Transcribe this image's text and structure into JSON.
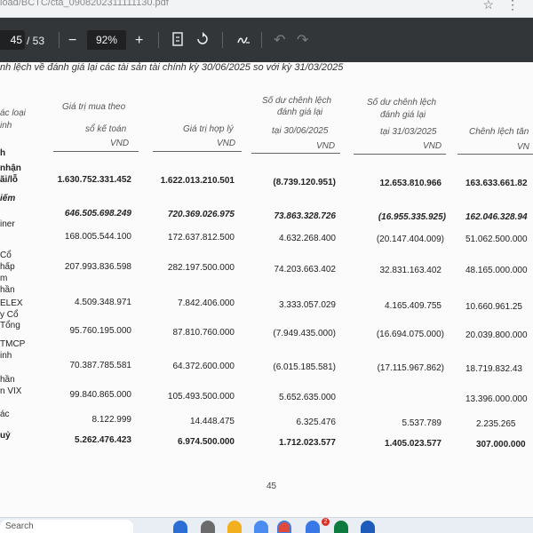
{
  "browser": {
    "url_fragment": "load/BCTC/cta_0908202311111130.pdf"
  },
  "toolbar": {
    "current_page": "45",
    "total_pages": "/ 53",
    "minus": "−",
    "zoom": "92%",
    "plus": "+"
  },
  "document": {
    "title": "nh lệch về đánh giá lại các tài sản tài chính kỳ 30/06/2025 so với kỳ 31/03/2025",
    "headers": {
      "col0": [
        "ác loại",
        "inh"
      ],
      "col1": [
        "Giá trị mua theo",
        "sổ kế toán",
        "VND"
      ],
      "col2": [
        "Giá trị hợp lý",
        "VND"
      ],
      "col3": [
        "Số dư chênh lệch",
        "đánh giá lại",
        "tại 30/06/2025",
        "VND"
      ],
      "col4": [
        "Số dư chênh lệch",
        "đánh giá lại",
        "tại 31/03/2025",
        "VND"
      ],
      "col5": [
        "Chênh lệch tăn",
        "VN"
      ]
    },
    "labels": [
      "h",
      "nhận",
      "ãi/lỗ",
      "iếm",
      "iner",
      "Cổ",
      "hấp",
      "m",
      "hần",
      "ELEX",
      "y Cổ",
      "Tổng",
      "TMCP",
      "inh",
      "hần",
      "n VIX",
      "ác",
      "uỷ"
    ],
    "rows": [
      [
        "1.630.752.331.452",
        "1.622.013.210.501",
        "(8.739.120.951)",
        "12.653.810.966",
        "163.633.661.82"
      ],
      [
        "646.505.698.249",
        "720.369.026.975",
        "73.863.328.726",
        "(16.955.335.925)",
        "162.046.328.94"
      ],
      [
        "168.005.544.100",
        "172.637.812.500",
        "4.632.268.400",
        "(20.147.404.009)",
        "51.062.500.000"
      ],
      [
        "207.993.836.598",
        "282.197.500.000",
        "74.203.663.402",
        "32.831.163.402",
        "48.165.000.000"
      ],
      [
        "4.509.348.971",
        "7.842.406.000",
        "3.333.057.029",
        "4.165.409.755",
        "10.660.961.25"
      ],
      [
        "95.760.195.000",
        "87.810.760.000",
        "(7.949.435.000)",
        "(16.694.075.000)",
        "20.039.800.000"
      ],
      [
        "70.387.785.581",
        "64.372.600.000",
        "(6.015.185.581)",
        "(17.115.967.862)",
        "18.719.832.43"
      ],
      [
        "99.840.865.000",
        "105.493.500.000",
        "5.652.635.000",
        "",
        "13.396.000.000"
      ],
      [
        "8.122.999",
        "14.448.475",
        "6.325.476",
        "5.537.789",
        "2.235.265"
      ],
      [
        "5.262.476.423",
        "6.974.500.000",
        "1.712.023.577",
        "1.405.023.577",
        "307.000.000"
      ]
    ],
    "page_number": "45"
  },
  "taskbar": {
    "search_placeholder": "Search",
    "badge_count": "2"
  }
}
